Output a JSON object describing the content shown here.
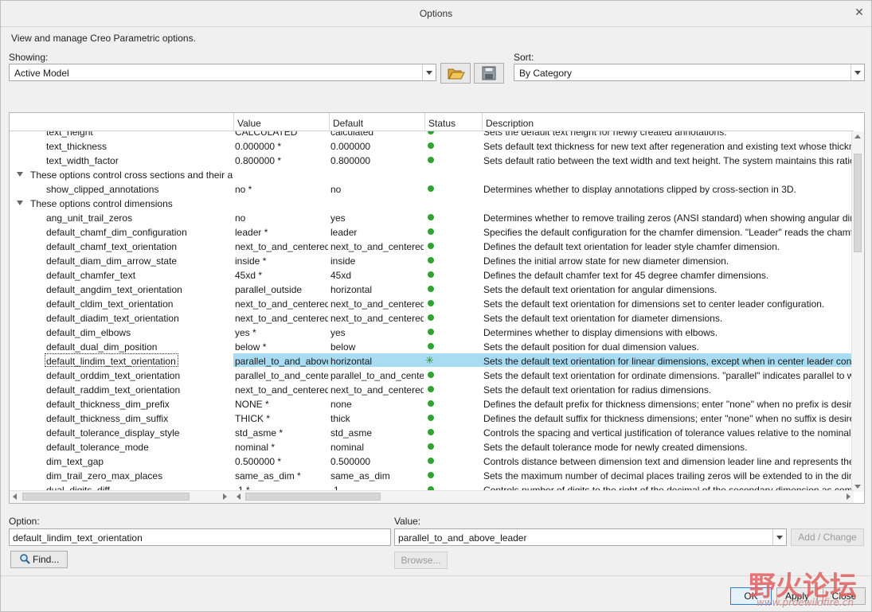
{
  "window": {
    "title": "Options",
    "subtitle": "View and manage Creo Parametric options."
  },
  "showing": {
    "label": "Showing:",
    "value": "Active Model"
  },
  "sort": {
    "label": "Sort:",
    "value": "By Category"
  },
  "table": {
    "columns": [
      "",
      "Value",
      "Default",
      "Status",
      "Description"
    ],
    "rows": [
      {
        "name": "text_height",
        "value": "CALCULATED",
        "default": "calculated",
        "desc": "Sets the default text height for newly created annotations."
      },
      {
        "name": "text_thickness",
        "value": "0.000000 *",
        "default": "0.000000",
        "desc": "Sets default text thickness for new text after regeneration and existing text whose thickness"
      },
      {
        "name": "text_width_factor",
        "value": "0.800000 *",
        "default": "0.800000",
        "desc": "Sets default ratio between the text width and text height. The system maintains this ratio"
      },
      {
        "group": true,
        "name": "These options control cross sections and their ar"
      },
      {
        "name": "show_clipped_annotations",
        "value": "no *",
        "default": "no",
        "desc": "Determines whether to display annotations clipped by cross-section in 3D."
      },
      {
        "group": true,
        "name": "These options control dimensions"
      },
      {
        "name": "ang_unit_trail_zeros",
        "value": "no",
        "default": "yes",
        "desc": "Determines whether to remove trailing zeros (ANSI standard) when showing angular dim"
      },
      {
        "name": "default_chamf_dim_configuration",
        "value": "leader *",
        "default": "leader",
        "desc": "Specifies the default configuration for the chamfer dimension. \"Leader\" reads the chamf"
      },
      {
        "name": "default_chamf_text_orientation",
        "value": "next_to_and_centered",
        "default": "next_to_and_centered",
        "desc": "Defines the default text orientation for leader style chamfer dimension."
      },
      {
        "name": "default_diam_dim_arrow_state",
        "value": "inside *",
        "default": "inside",
        "desc": "Defines the initial arrow state for new diameter dimension."
      },
      {
        "name": "default_chamfer_text",
        "value": "45xd *",
        "default": "45xd",
        "desc": "Defines the default chamfer text for 45 degree chamfer dimensions."
      },
      {
        "name": "default_angdim_text_orientation",
        "value": "parallel_outside",
        "default": "horizontal",
        "desc": "Sets the default text orientation for angular dimensions."
      },
      {
        "name": "default_cldim_text_orientation",
        "value": "next_to_and_centered",
        "default": "next_to_and_centered",
        "desc": "Sets the default text orientation for dimensions set to center leader configuration."
      },
      {
        "name": "default_diadim_text_orientation",
        "value": "next_to_and_centered",
        "default": "next_to_and_centered",
        "desc": "Sets the default text orientation for diameter dimensions."
      },
      {
        "name": "default_dim_elbows",
        "value": "yes *",
        "default": "yes",
        "desc": "Determines whether to display dimensions with elbows."
      },
      {
        "name": "default_dual_dim_position",
        "value": "below *",
        "default": "below",
        "desc": "Sets the default position for dual dimension values."
      },
      {
        "name": "default_lindim_text_orientation",
        "value": "parallel_to_and_above",
        "default": "horizontal",
        "desc": "Sets the default text orientation for linear dimensions, except when in center leader conf",
        "selected": true
      },
      {
        "name": "default_orddim_text_orientation",
        "value": "parallel_to_and_center",
        "default": "parallel_to_and_center",
        "desc": "Sets the default text orientation for ordinate dimensions. \"parallel\" indicates parallel to w"
      },
      {
        "name": "default_raddim_text_orientation",
        "value": "next_to_and_centered",
        "default": "next_to_and_centered",
        "desc": "Sets the default text orientation for radius dimensions."
      },
      {
        "name": "default_thickness_dim_prefix",
        "value": "NONE *",
        "default": "none",
        "desc": "Defines the default prefix for thickness dimensions; enter \"none\" when no prefix is desire"
      },
      {
        "name": "default_thickness_dim_suffix",
        "value": "THICK *",
        "default": "thick",
        "desc": "Defines the default suffix for thickness dimensions; enter \"none\" when no suffix is desire"
      },
      {
        "name": "default_tolerance_display_style",
        "value": "std_asme *",
        "default": "std_asme",
        "desc": "Controls the spacing and vertical justification of tolerance values relative to the nominal"
      },
      {
        "name": "default_tolerance_mode",
        "value": "nominal *",
        "default": "nominal",
        "desc": "Sets the default tolerance mode for newly created dimensions."
      },
      {
        "name": "dim_text_gap",
        "value": "0.500000 *",
        "default": "0.500000",
        "desc": "Controls distance between dimension text and dimension leader line and represents the"
      },
      {
        "name": "dim_trail_zero_max_places",
        "value": "same_as_dim *",
        "default": "same_as_dim",
        "desc": "Sets the maximum number of decimal places trailing zeros will be extended to in the dim"
      },
      {
        "name": "dual_digits_diff",
        "value": "-1 *",
        "default": "-1",
        "desc": "Controls number of digits to the right of the decimal of the secondary dimension as com"
      }
    ]
  },
  "option": {
    "label": "Option:",
    "value": "default_lindim_text_orientation"
  },
  "valuefield": {
    "label": "Value:",
    "value": "parallel_to_and_above_leader"
  },
  "buttons": {
    "add_change": "Add / Change",
    "find": "Find...",
    "browse": "Browse...",
    "ok": "OK",
    "apply": "Apply",
    "close": "Close"
  },
  "watermark": {
    "main": "野火论坛",
    "sub": "www.proewildfire.cn"
  },
  "icons": {
    "open": "folder-open-icon",
    "save": "save-icon",
    "find": "magnifier-icon",
    "status_ok": "green-dot-icon",
    "status_selected": "green-star-icon"
  },
  "colors": {
    "selection": "#a8dcf3",
    "status_green": "#2ea42e"
  }
}
